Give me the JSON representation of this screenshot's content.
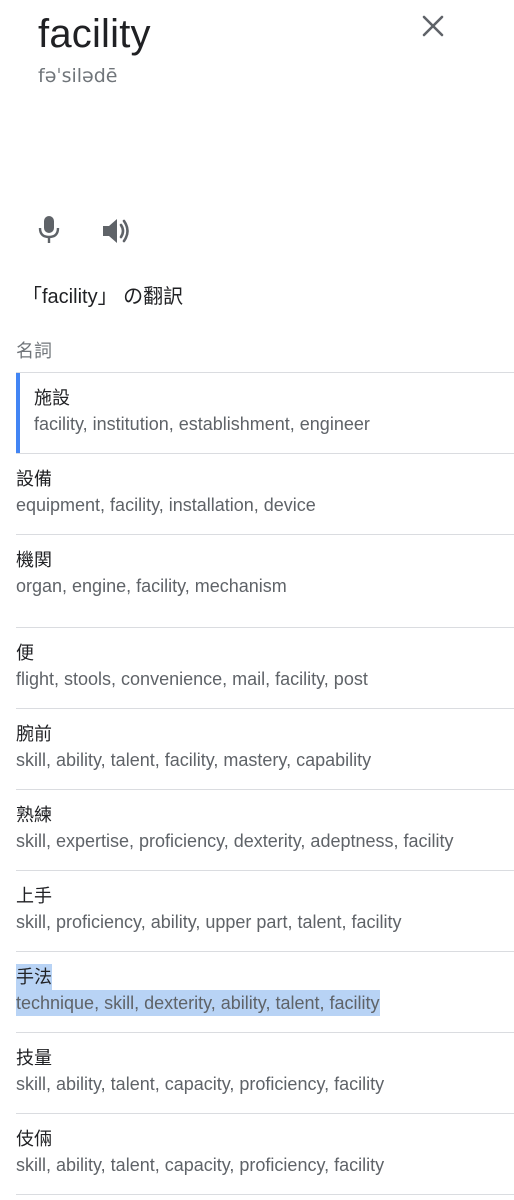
{
  "header": {
    "word": "facility",
    "phonetic": "fəˈsilədē"
  },
  "icons": {
    "close": "close-icon",
    "mic": "microphone-icon",
    "speaker": "speaker-icon"
  },
  "colors": {
    "accent": "#4285f4",
    "highlight": "#b8d3f5",
    "text": "#202124",
    "secondary_text": "#5f6368",
    "divider": "#dadce0"
  },
  "translation": {
    "heading": "「facility」 の翻訳",
    "part_of_speech": "名詞",
    "entries": [
      {
        "term": "施設",
        "synonyms": "facility, institution, establishment, engineer"
      },
      {
        "term": "設備",
        "synonyms": "equipment, facility, installation, device"
      },
      {
        "term": "機関",
        "synonyms": "organ, engine, facility, mechanism"
      },
      {
        "term": "便",
        "synonyms": "flight, stools, convenience, mail, facility, post"
      },
      {
        "term": "腕前",
        "synonyms": "skill, ability, talent, facility, mastery, capability"
      },
      {
        "term": "熟練",
        "synonyms": "skill, expertise, proficiency, dexterity, adeptness, facility"
      },
      {
        "term": "上手",
        "synonyms": "skill, proficiency, ability, upper part, talent, facility"
      },
      {
        "term": "手法",
        "synonyms": "technique, skill, dexterity, ability, talent, facility"
      },
      {
        "term": "技量",
        "synonyms": "skill, ability, talent, capacity, proficiency, facility"
      },
      {
        "term": "伎倆",
        "synonyms": "skill, ability, talent, capacity, proficiency, facility"
      }
    ]
  }
}
